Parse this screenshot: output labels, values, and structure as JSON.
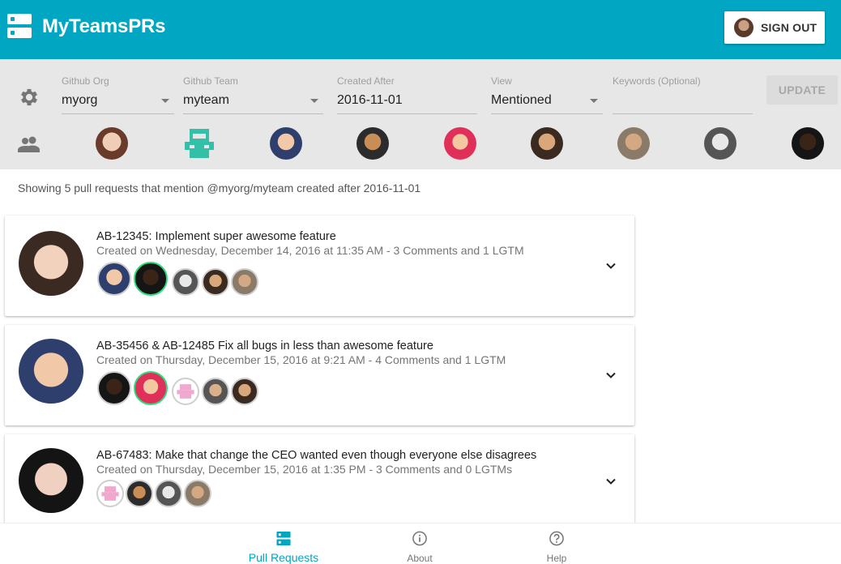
{
  "app": {
    "title": "MyTeamsPRs",
    "accent_color": "#00a6c2",
    "logo_icon": "server-stack-icon",
    "sign_out_label": "SIGN OUT"
  },
  "filters": {
    "settings_icon": "gear-icon",
    "github_org": {
      "label": "Github Org",
      "value": "myorg"
    },
    "github_team": {
      "label": "Github Team",
      "value": "myteam"
    },
    "created_after": {
      "label": "Created After",
      "value": "2016-11-01"
    },
    "view": {
      "label": "View",
      "value": "Mentioned"
    },
    "keywords": {
      "placeholder": "Keywords (Optional)",
      "value": ""
    },
    "update_label": "UPDATE"
  },
  "team": {
    "icon": "people-icon",
    "member_count": 9
  },
  "status_text": "Showing 5 pull requests that mention @myorg/myteam created after 2016-11-01",
  "pull_requests": [
    {
      "title": "AB-12345: Implement super awesome feature",
      "meta": "Created on Wednesday, December 14, 2016 at 11:35 AM - 3 Comments and 1 LGTM",
      "reviewers": [
        {
          "approved": false
        },
        {
          "approved": true
        },
        {
          "approved": false
        },
        {
          "approved": false
        },
        {
          "approved": false
        }
      ]
    },
    {
      "title": "AB-35456 & AB-12485 Fix all bugs in less than awesome feature",
      "meta": "Created on Thursday, December 15, 2016 at 9:21 AM - 4 Comments and 1 LGTM",
      "reviewers": [
        {
          "approved": false
        },
        {
          "approved": true
        },
        {
          "approved": false
        },
        {
          "approved": false
        },
        {
          "approved": false
        }
      ]
    },
    {
      "title": "AB-67483: Make that change the CEO wanted even though everyone else disagrees",
      "meta": "Created on Thursday, December 15, 2016 at 1:35 PM - 3 Comments and 0 LGTMs",
      "reviewers": [
        {
          "approved": false
        },
        {
          "approved": false
        },
        {
          "approved": false
        },
        {
          "approved": false
        }
      ]
    }
  ],
  "bottom_nav": [
    {
      "label": "Pull Requests",
      "icon": "server-stack-icon",
      "active": true
    },
    {
      "label": "About",
      "icon": "info-icon",
      "active": false
    },
    {
      "label": "Help",
      "icon": "help-icon",
      "active": false
    }
  ]
}
